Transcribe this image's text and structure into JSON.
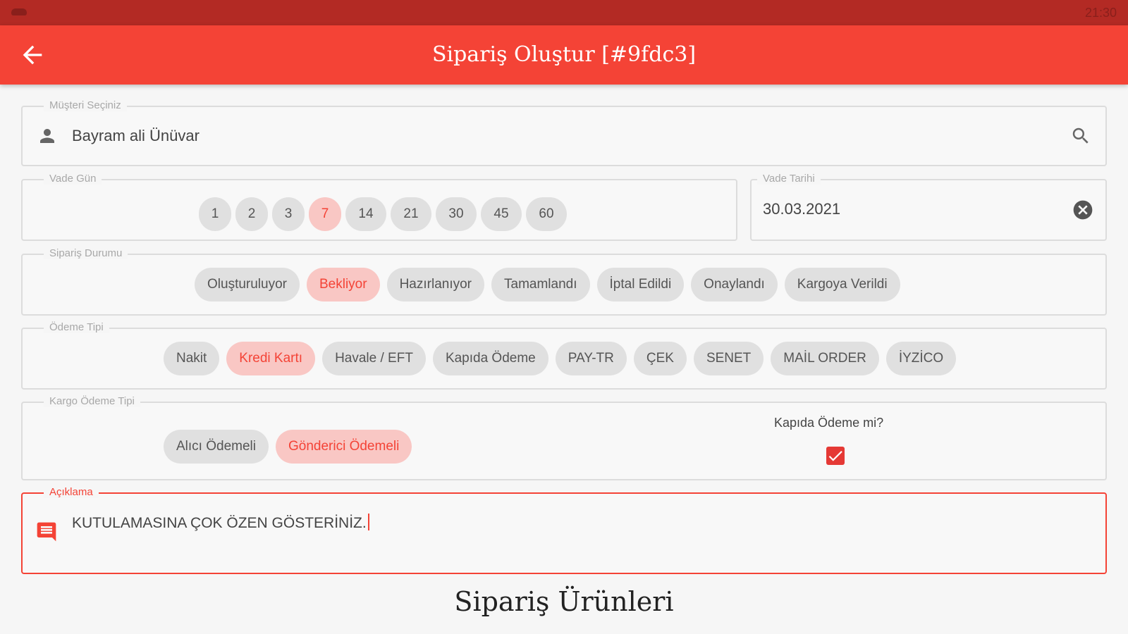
{
  "status_bar": {
    "time": "21:30"
  },
  "app_bar": {
    "title": "Sipariş Oluştur [#9fdc3]",
    "back_icon": "arrow-back-icon"
  },
  "customer": {
    "label": "Müşteri Seçiniz",
    "value": "Bayram ali Ünüvar",
    "person_icon": "person-icon",
    "search_icon": "search-icon"
  },
  "due_days": {
    "label": "Vade Gün",
    "options": [
      "1",
      "2",
      "3",
      "7",
      "14",
      "21",
      "30",
      "45",
      "60"
    ],
    "selected": "7"
  },
  "due_date": {
    "label": "Vade Tarihi",
    "value": "30.03.2021",
    "clear_icon": "clear-circle-icon"
  },
  "order_status": {
    "label": "Sipariş Durumu",
    "options": [
      "Oluşturuluyor",
      "Bekliyor",
      "Hazırlanıyor",
      "Tamamlandı",
      "İptal Edildi",
      "Onaylandı",
      "Kargoya Verildi"
    ],
    "selected": "Bekliyor"
  },
  "payment_type": {
    "label": "Ödeme Tipi",
    "options": [
      "Nakit",
      "Kredi Kartı",
      "Havale / EFT",
      "Kapıda Ödeme",
      "PAY-TR",
      "ÇEK",
      "SENET",
      "MAİL ORDER",
      "İYZİCO"
    ],
    "selected": "Kredi Kartı"
  },
  "cargo_payment": {
    "label": "Kargo Ödeme Tipi",
    "options": [
      "Alıcı Ödemeli",
      "Gönderici Ödemeli"
    ],
    "selected": "Gönderici Ödemeli",
    "cod_label": "Kapıda Ödeme mi?",
    "cod_checked": true
  },
  "note": {
    "label": "Açıklama",
    "value": "KUTULAMASINA ÇOK ÖZEN GÖSTERİNİZ.",
    "icon": "comment-icon"
  },
  "products_title": "Sipariş Ürünleri",
  "colors": {
    "primary": "#f44336",
    "status_bar": "#b32a24",
    "chip_selected_bg": "#f9c7c4",
    "chip_bg": "#e0e0e0"
  }
}
